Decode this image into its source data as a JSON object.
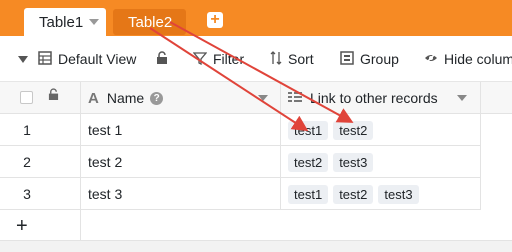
{
  "tabs": [
    {
      "label": "Table1",
      "active": true
    },
    {
      "label": "Table2",
      "active": false
    }
  ],
  "toolbar": {
    "default_view": "Default View",
    "filter": "Filter",
    "sort": "Sort",
    "group": "Group",
    "hide_columns": "Hide colum"
  },
  "columns": {
    "name": "Name",
    "link": "Link to other records"
  },
  "rows": [
    {
      "num": "1",
      "name": "test 1",
      "links": [
        "test1",
        "test2"
      ]
    },
    {
      "num": "2",
      "name": "test 2",
      "links": [
        "test2",
        "test3"
      ]
    },
    {
      "num": "3",
      "name": "test 3",
      "links": [
        "test1",
        "test2",
        "test3"
      ]
    }
  ],
  "colors": {
    "tabbar": "#f68a24",
    "inactive_tab": "#e57717",
    "annotation_arrow": "#e0443a"
  }
}
